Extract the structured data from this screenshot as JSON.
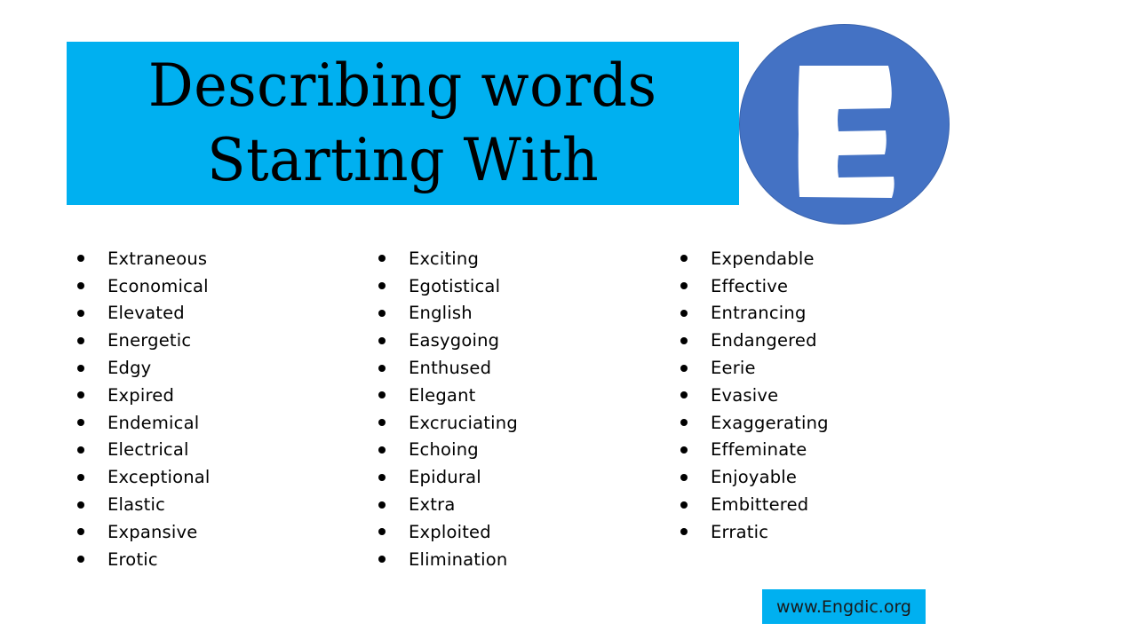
{
  "title": {
    "line1": "Describing words",
    "line2": "Starting With",
    "letter": "E"
  },
  "colors": {
    "title_bg": "#00b0f0",
    "circle_bg": "#4472c4",
    "letter": "#ffffff",
    "footer_bg": "#00b0f0"
  },
  "icons": {
    "bullet": "bullet-dot-icon",
    "letter_badge": "letter-e-icon"
  },
  "columns": [
    {
      "items": [
        "Extraneous",
        "Economical",
        "Elevated",
        "Energetic",
        "Edgy",
        "Expired",
        "Endemical",
        "Electrical",
        "Exceptional",
        "Elastic",
        "Expansive",
        "Erotic"
      ]
    },
    {
      "items": [
        "Exciting",
        "Egotistical",
        "English",
        "Easygoing",
        "Enthused",
        "Elegant",
        "Excruciating",
        "Echoing",
        "Epidural",
        "Extra",
        "Exploited",
        "Elimination"
      ]
    },
    {
      "items": [
        "Expendable",
        "Effective",
        "Entrancing",
        "Endangered",
        "Eerie",
        "Evasive",
        "Exaggerating",
        "Effeminate",
        "Enjoyable",
        "Embittered",
        "Erratic"
      ]
    }
  ],
  "footer": {
    "link_text": "www.Engdic.org"
  }
}
